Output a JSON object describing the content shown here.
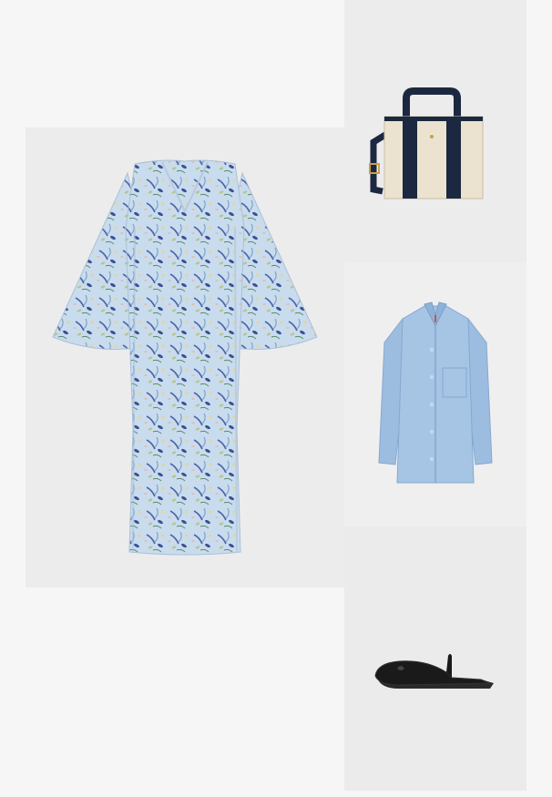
{
  "outfit": {
    "items": [
      {
        "name": "floral-maxi-dress",
        "icon": "dress-icon",
        "background": "#ececec"
      },
      {
        "name": "canvas-tote-bag",
        "icon": "tote-bag-icon",
        "background": "#ececec"
      },
      {
        "name": "blue-overshirt",
        "icon": "shirt-icon",
        "background": "#efefef"
      },
      {
        "name": "black-ballet-flat-mule",
        "icon": "shoe-icon",
        "background": "#ebebeb"
      }
    ],
    "colors": {
      "page": "#f6f6f6",
      "dress_base": "#c9dcee",
      "dress_print": "#4c63a8",
      "bag_canvas": "#ebe3cf",
      "bag_navy": "#1c2840",
      "shirt": "#9dbde0",
      "shoe": "#1a1a1a"
    }
  }
}
